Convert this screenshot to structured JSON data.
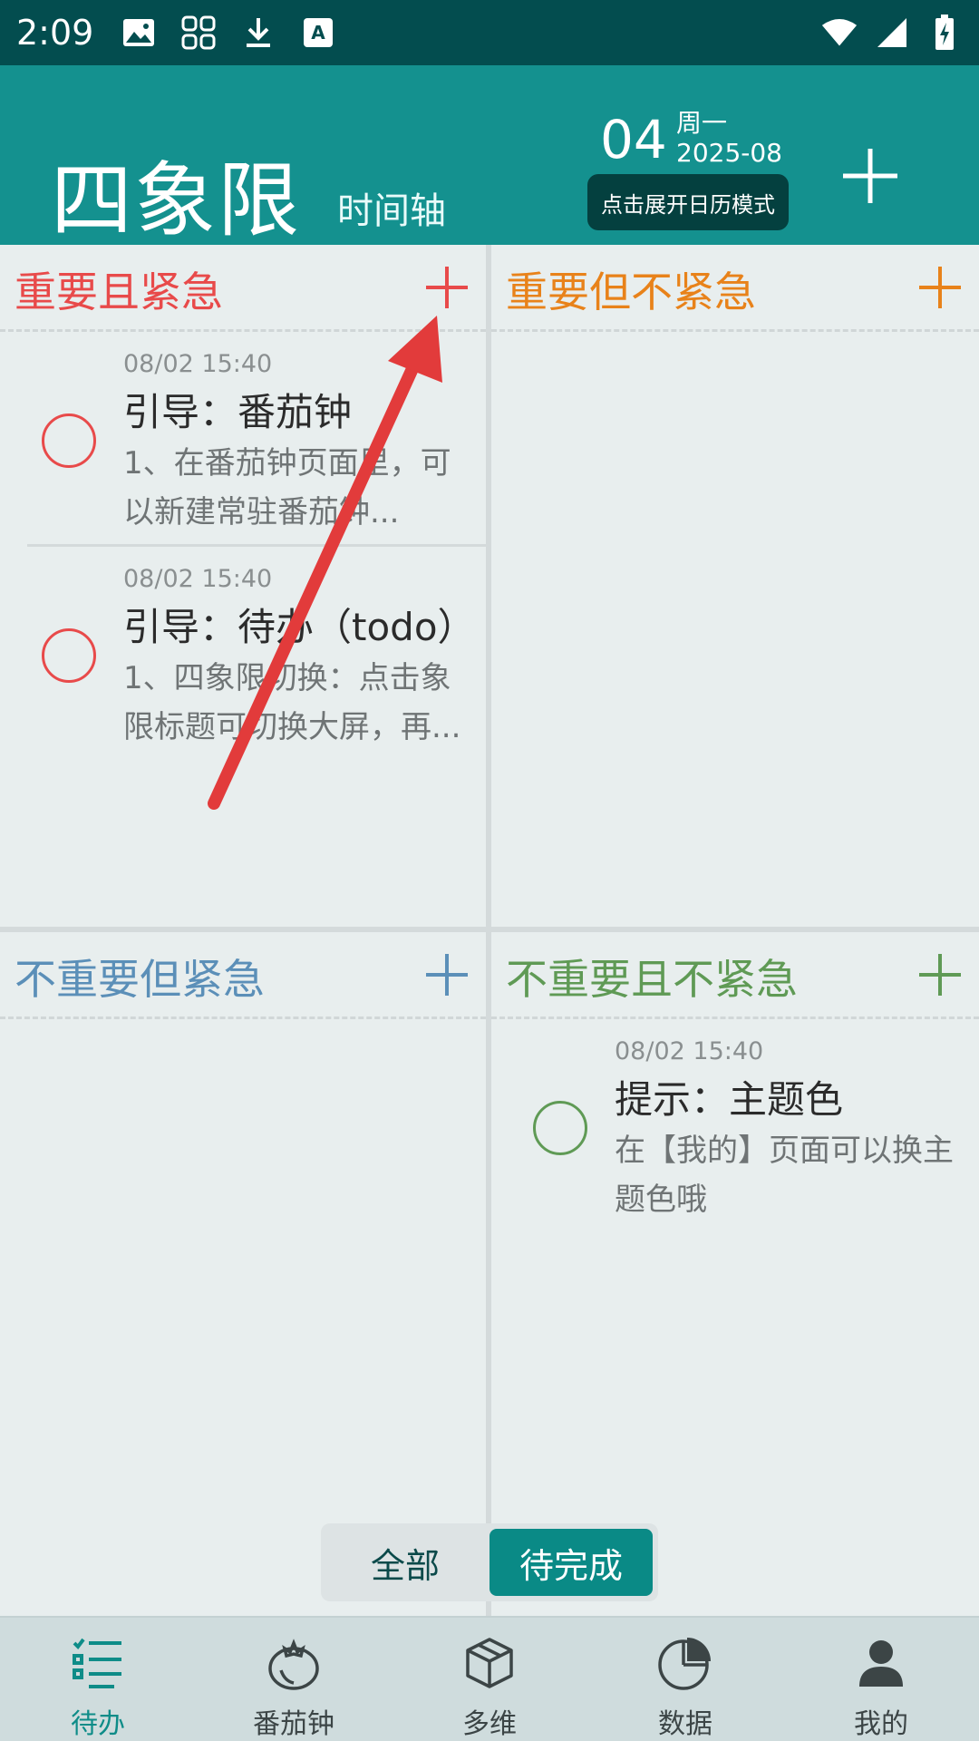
{
  "status_bar": {
    "time": "2:09"
  },
  "header": {
    "title": "四象限",
    "timeline_label": "时间轴",
    "date_day": "04",
    "date_weekday": "周一",
    "date_month": "2025-08",
    "calendar_tip": "点击展开日历模式"
  },
  "colors": {
    "header_bg": "#14918f",
    "status_bar_bg": "#034d4f",
    "q1": "#e84a4a",
    "q2": "#e8821a",
    "q3": "#5b8fb8",
    "q4": "#5f9a55",
    "accent": "#0a8a86"
  },
  "quadrants": [
    {
      "title": "重要且紧急",
      "tasks": [
        {
          "time": "08/02 15:40",
          "title": "引导：番茄钟",
          "desc": "1、在番茄钟页面里，可以新建常驻番茄钟..."
        },
        {
          "time": "08/02 15:40",
          "title": "引导：待办（todo）",
          "desc": "1、四象限切换：点击象限标题可切换大屏，再..."
        }
      ]
    },
    {
      "title": "重要但不紧急",
      "tasks": []
    },
    {
      "title": "不重要但紧急",
      "tasks": []
    },
    {
      "title": "不重要且不紧急",
      "tasks": [
        {
          "time": "08/02 15:40",
          "title": "提示：主题色",
          "desc": "在【我的】页面可以换主题色哦"
        }
      ]
    }
  ],
  "filter": {
    "all_label": "全部",
    "pending_label": "待完成",
    "selected": "待完成"
  },
  "bottom_nav": [
    {
      "label": "待办",
      "icon": "todo-list-icon",
      "active": true
    },
    {
      "label": "番茄钟",
      "icon": "tomato-icon",
      "active": false
    },
    {
      "label": "多维",
      "icon": "cube-icon",
      "active": false
    },
    {
      "label": "数据",
      "icon": "pie-chart-icon",
      "active": false
    },
    {
      "label": "我的",
      "icon": "person-icon",
      "active": false
    }
  ]
}
